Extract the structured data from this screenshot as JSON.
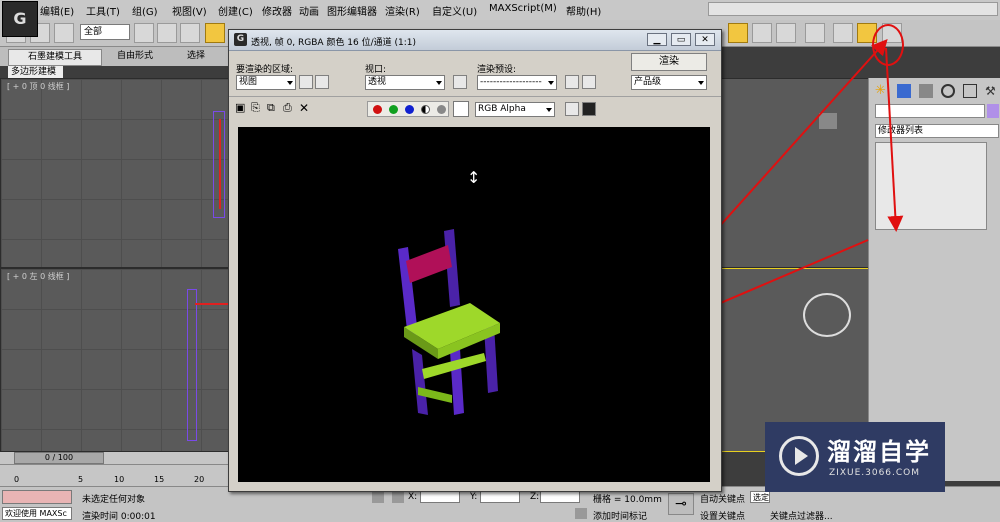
{
  "menubar": {
    "logo": "G",
    "items": [
      "编辑(E)",
      "工具(T)",
      "组(G)",
      "视图(V)",
      "创建(C)",
      "修改器",
      "动画",
      "图形编辑器",
      "渲染(R)",
      "自定义(U)",
      "MAXScript(M)",
      "帮助(H)"
    ]
  },
  "toolbar": {
    "selection_filter": "全部"
  },
  "ribbon": {
    "tabs": [
      "石墨建模工具",
      "自由形式",
      "选择"
    ],
    "subtab": "多边形建模"
  },
  "viewports": {
    "top_label": "[ + 0 顶 0 线框 ]",
    "left_label": "[ + 0 左 0 线框 ]"
  },
  "render_window": {
    "title": "透视, 帧 0, RGBA 颜色 16 位/通道 (1:1)",
    "area_label": "要渲染的区域:",
    "area_value": "视图",
    "viewport_label": "视口:",
    "viewport_value": "透视",
    "preset_label": "渲染预设:",
    "preset_value": "-------------------",
    "render_button": "渲染",
    "quality_value": "产品级",
    "channel_value": "RGB Alpha"
  },
  "command_panel": {
    "modifier_list": "修改器列表"
  },
  "timeline": {
    "frame_counter": "0 / 100",
    "ticks": [
      "0",
      "5",
      "10",
      "15",
      "20"
    ]
  },
  "statusbar": {
    "welcome": "欢迎使用 MAXSc",
    "status_text": "未选定任何对象",
    "render_time": "渲染时间 0:00:01",
    "x_label": "X:",
    "y_label": "Y:",
    "z_label": "Z:",
    "grid": "栅格 = 10.0mm",
    "add_time_tag": "添加时间标记",
    "autokey": "自动关键点",
    "set_key": "设置关键点",
    "selected": "选定",
    "key_filter": "关键点过滤器..."
  },
  "watermark": {
    "brand": "溜溜自学",
    "url": "ZIXUE.3066.COM"
  },
  "colors": {
    "highlight": "#f2c640",
    "annotation_red": "#e01010",
    "chair_purple": "#5a2ac8",
    "chair_seat": "#9ed82a",
    "chair_back": "#b01058"
  }
}
